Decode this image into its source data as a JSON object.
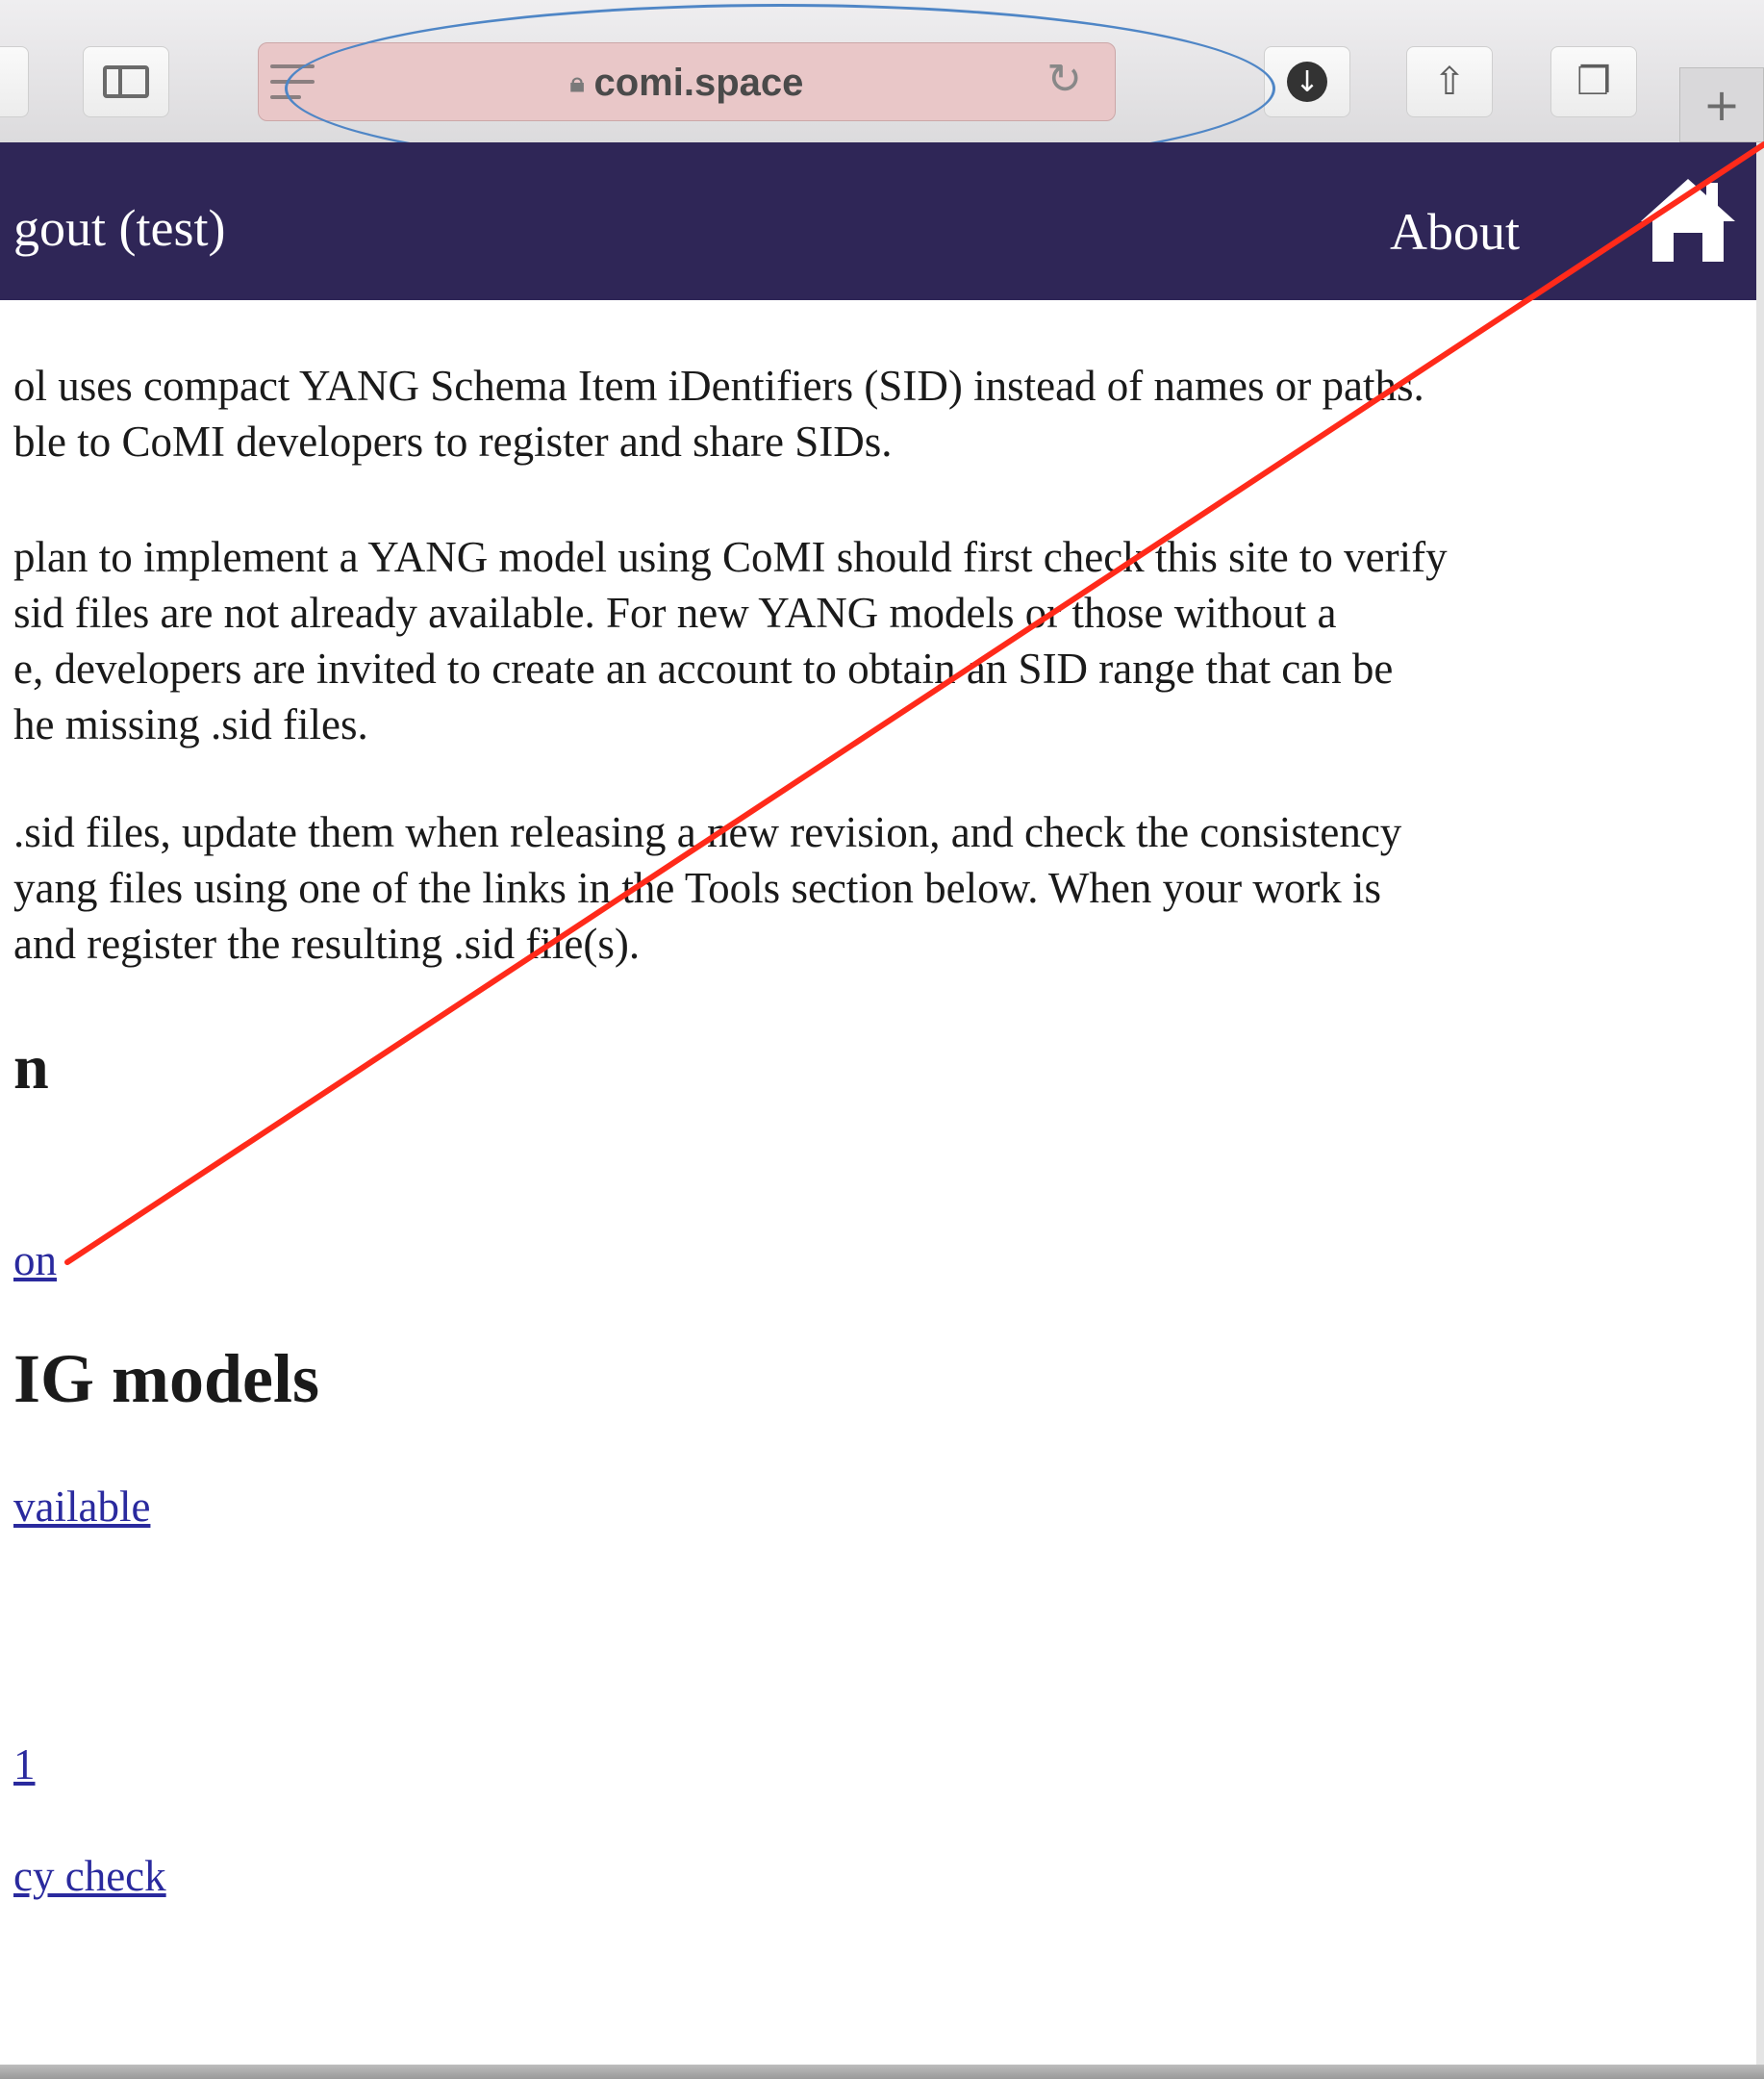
{
  "browser": {
    "url": "comi.space",
    "buttons": {
      "back": "",
      "new_tab": "+"
    }
  },
  "nav": {
    "logout": "gout (test)",
    "about": "About"
  },
  "paragraphs": [
    {
      "lines": [
        "ol uses compact YANG Schema Item iDentifiers (SID) instead of names or paths.",
        "ble to CoMI developers to register and share SIDs."
      ]
    },
    {
      "lines": [
        "plan to implement a YANG model using CoMI should first check this site to verify",
        "sid files are not already available. For new YANG models or those without a",
        "e, developers are invited to create an account to obtain an SID range that can be",
        "he missing .sid files."
      ]
    },
    {
      "lines": [
        ".sid files, update them when releasing a new revision, and check the consistency",
        "yang files using one of the links in the Tools section below. When your work is",
        "and register the resulting .sid file(s)."
      ]
    }
  ],
  "headings": {
    "info": "n",
    "yang": "IG models"
  },
  "links": {
    "info_link": "on",
    "available": "vailable",
    "tool1": "1",
    "consistency": "cy check"
  },
  "colors": {
    "navbar": "#2f2657",
    "address_highlight": "#e9c7c8",
    "ellipse": "#4f86c6",
    "annotation_line": "#ff2a1a",
    "link": "#2a2a9e"
  }
}
